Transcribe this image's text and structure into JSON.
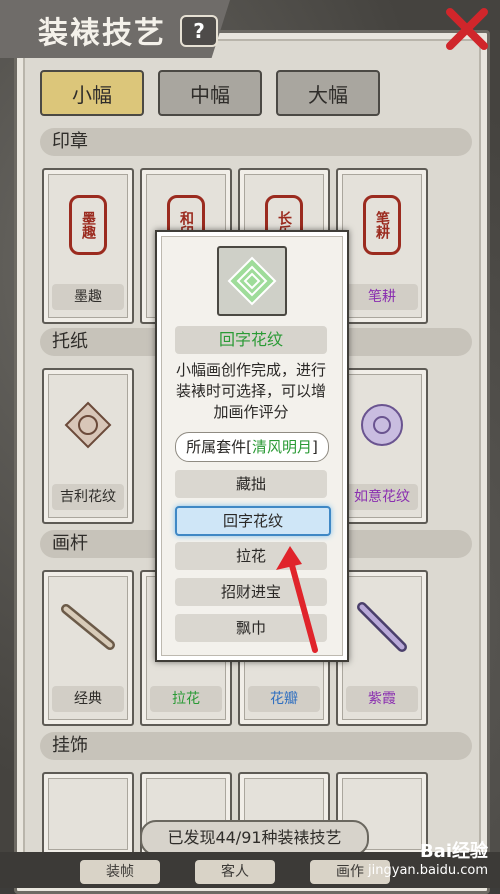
{
  "header": {
    "title": "装裱技艺",
    "help_label": "?"
  },
  "tabs": [
    {
      "label": "小幅",
      "active": true
    },
    {
      "label": "中幅",
      "active": false
    },
    {
      "label": "大幅",
      "active": false
    }
  ],
  "sections": {
    "seal": "印章",
    "paper": "托纸",
    "rod": "画杆",
    "ornament": "挂饰"
  },
  "seal_cards": [
    {
      "name": "墨趣",
      "color": "default",
      "glyph": "墨趣"
    },
    {
      "name": "",
      "color": "default",
      "glyph": "和印"
    },
    {
      "name": "",
      "color": "default",
      "glyph": "长乐"
    },
    {
      "name": "笔耕",
      "color": "purple",
      "glyph": "笔耕"
    }
  ],
  "paper_cards": [
    {
      "name": "吉利花纹",
      "color": "default"
    },
    {
      "name": "如意花纹",
      "color": "purple"
    }
  ],
  "rod_cards": [
    {
      "name": "经典",
      "color": "default"
    },
    {
      "name": "拉花",
      "color": "green"
    },
    {
      "name": "花瓣",
      "color": "blue"
    },
    {
      "name": "紫霞",
      "color": "purple"
    }
  ],
  "footer": {
    "discovered": "已发现44/91种装裱技艺"
  },
  "popup": {
    "item_name": "回字花纹",
    "description": "小幅画创作完成，进行装裱时可选择，可以增加画作评分",
    "set_prefix": "所属套件[",
    "set_name": "清风明月",
    "set_suffix": "]",
    "options": [
      {
        "label": "藏拙",
        "selected": false
      },
      {
        "label": "回字花纹",
        "selected": true
      },
      {
        "label": "拉花",
        "selected": false
      },
      {
        "label": "招财进宝",
        "selected": false
      },
      {
        "label": "飘巾",
        "selected": false
      }
    ]
  },
  "bottom_tabs": [
    "装帧",
    "客人",
    "画作"
  ],
  "watermark": {
    "brand": "Bai经验",
    "url": "jingyan.baidu.com"
  },
  "colors": {
    "accent_green": "#2a9a35",
    "accent_purple": "#8a2fb0",
    "accent_blue": "#2f6fc0",
    "tab_active": "#dcc67a",
    "selected_blue": "#3f88c5",
    "arrow_red": "#e0242b"
  }
}
